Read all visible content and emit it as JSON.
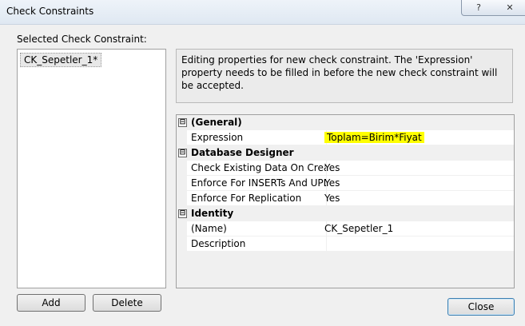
{
  "window": {
    "title": "Check Constraints",
    "help_button": "?",
    "close_button": "✕"
  },
  "list": {
    "label": "Selected Check Constraint:",
    "items": [
      "CK_Sepetler_1*"
    ]
  },
  "info_text": "Editing properties for new check constraint.  The 'Expression' property needs to be filled in before the new check constraint will be accepted.",
  "properties": {
    "general": {
      "toggle": "⊟",
      "label": "(General)",
      "expression": {
        "name": "Expression",
        "value": "Toplam=Birim*Fiyat",
        "highlight": "#ffff00"
      }
    },
    "database_designer": {
      "toggle": "⊟",
      "label": "Database Designer",
      "check_existing": {
        "name": "Check Existing Data On Creatio",
        "value": "Yes"
      },
      "enforce_inserts": {
        "name": "Enforce For INSERTs And UPDA",
        "value": "Yes"
      },
      "enforce_replication": {
        "name": "Enforce For Replication",
        "value": "Yes"
      }
    },
    "identity": {
      "toggle": "⊟",
      "label": "Identity",
      "name_prop": {
        "name": "(Name)",
        "value": "CK_Sepetler_1"
      },
      "description": {
        "name": "Description",
        "value": ""
      }
    }
  },
  "buttons": {
    "add": "Add",
    "delete": "Delete",
    "close": "Close"
  }
}
